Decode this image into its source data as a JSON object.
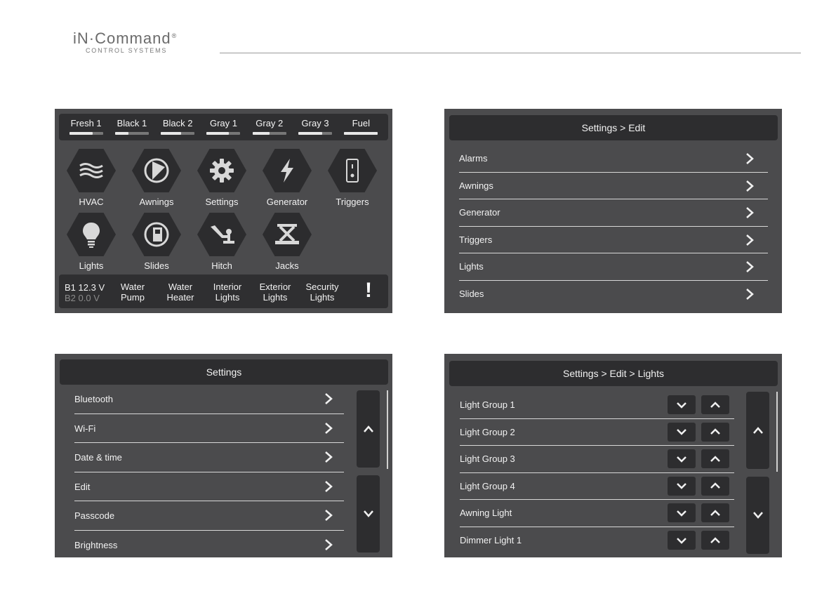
{
  "header": {
    "brand": "iN·Command",
    "registered": "®",
    "tagline": "CONTROL SYSTEMS"
  },
  "home": {
    "tanks": [
      {
        "label": "Fresh 1",
        "level": 0.7
      },
      {
        "label": "Black 1",
        "level": 0.4
      },
      {
        "label": "Black 2",
        "level": 0.6
      },
      {
        "label": "Gray 1",
        "level": 0.65
      },
      {
        "label": "Gray 2",
        "level": 0.5
      },
      {
        "label": "Gray 3",
        "level": 0.7
      },
      {
        "label": "Fuel",
        "level": 1.0
      }
    ],
    "tiles": [
      {
        "label": "HVAC",
        "icon": "hvac-icon"
      },
      {
        "label": "Awnings",
        "icon": "awning-icon"
      },
      {
        "label": "Settings",
        "icon": "gear-icon"
      },
      {
        "label": "Generator",
        "icon": "lightning-icon"
      },
      {
        "label": "Triggers",
        "icon": "switch-icon"
      },
      {
        "label": "Lights",
        "icon": "bulb-icon"
      },
      {
        "label": "Slides",
        "icon": "slide-icon"
      },
      {
        "label": "Hitch",
        "icon": "hitch-icon"
      },
      {
        "label": "Jacks",
        "icon": "jack-icon"
      }
    ],
    "battery": {
      "b1_label": "B1",
      "b1_value": "12.3 V",
      "b2_label": "B2",
      "b2_value": "0.0 V"
    },
    "quick_buttons": [
      "Water\nPump",
      "Water\nHeater",
      "Interior\nLights",
      "Exterior\nLights",
      "Security\nLights"
    ],
    "alert_symbol": "!"
  },
  "settings_edit": {
    "title": "Settings > Edit",
    "items": [
      "Alarms",
      "Awnings",
      "Generator",
      "Triggers",
      "Lights",
      "Slides"
    ]
  },
  "settings": {
    "title": "Settings",
    "items": [
      "Bluetooth",
      "Wi-Fi",
      "Date & time",
      "Edit",
      "Passcode",
      "Brightness"
    ]
  },
  "settings_edit_lights": {
    "title": "Settings > Edit > Lights",
    "items": [
      "Light Group 1",
      "Light Group 2",
      "Light Group 3",
      "Light Group 4",
      "Awning Light",
      "Dimmer Light 1"
    ]
  },
  "colors": {
    "panel_bg": "#4b4b4d",
    "bar_bg": "#2f2f31",
    "text": "#f2f2f2"
  }
}
